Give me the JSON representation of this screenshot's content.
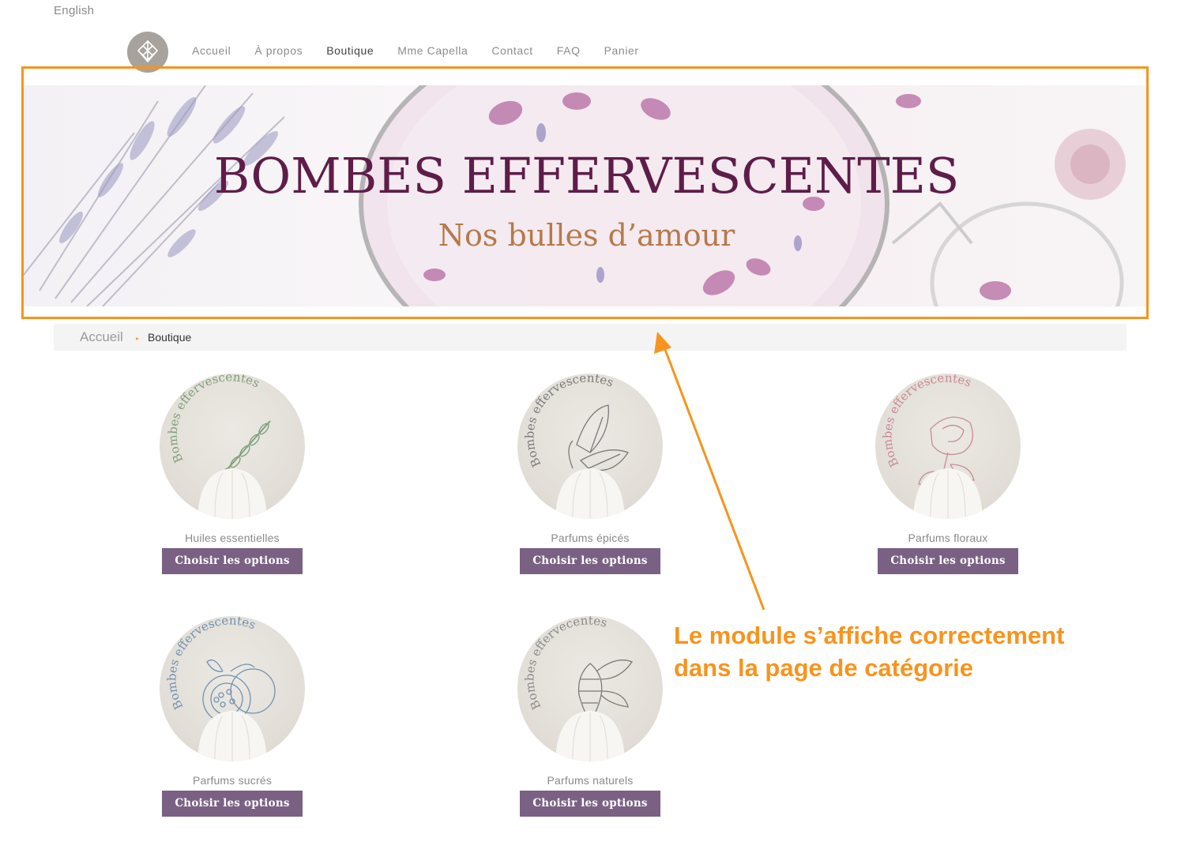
{
  "language_switch": "English",
  "nav": {
    "items": [
      "Accueil",
      "À propos",
      "Boutique",
      "Mme Capella",
      "Contact",
      "FAQ",
      "Panier"
    ],
    "active_index": 2
  },
  "hero": {
    "title": "BOMBES EFFERVESCENTES",
    "subtitle": "Nos bulles d’amour"
  },
  "breadcrumb": {
    "home": "Accueil",
    "separator": "▸",
    "current": "Boutique"
  },
  "products": [
    {
      "name": "Huiles essentielles",
      "button": "Choisir les options",
      "circle_text": "Bombes effervescentes",
      "illustration": "lavender-sprig-icon",
      "accent": "#7fa07c"
    },
    {
      "name": "Parfums épicés",
      "button": "Choisir les options",
      "circle_text": "Bombes effervescentes",
      "illustration": "mint-leaf-icon",
      "accent": "#7a7a7a"
    },
    {
      "name": "Parfums floraux",
      "button": "Choisir les options",
      "circle_text": "Bombes effervescentes",
      "illustration": "rose-flower-icon",
      "accent": "#c98a93"
    },
    {
      "name": "Parfums sucrés",
      "button": "Choisir les options",
      "circle_text": "Bombes effervescentes",
      "illustration": "passion-fruit-icon",
      "accent": "#6f93b0"
    },
    {
      "name": "Parfums naturels",
      "button": "Choisir les options",
      "circle_text": "Bombes effervecentes",
      "illustration": "hops-cone-icon",
      "accent": "#8a8a8a"
    }
  ],
  "annotation": {
    "line1": "Le module s’affiche correctement",
    "line2": "dans la page de catégorie",
    "color": "#f7941d"
  },
  "colors": {
    "button_bg": "#7a6184",
    "hero_title": "#5e1d48",
    "hero_subtitle": "#b57a4c",
    "highlight_frame": "#f7941d"
  }
}
